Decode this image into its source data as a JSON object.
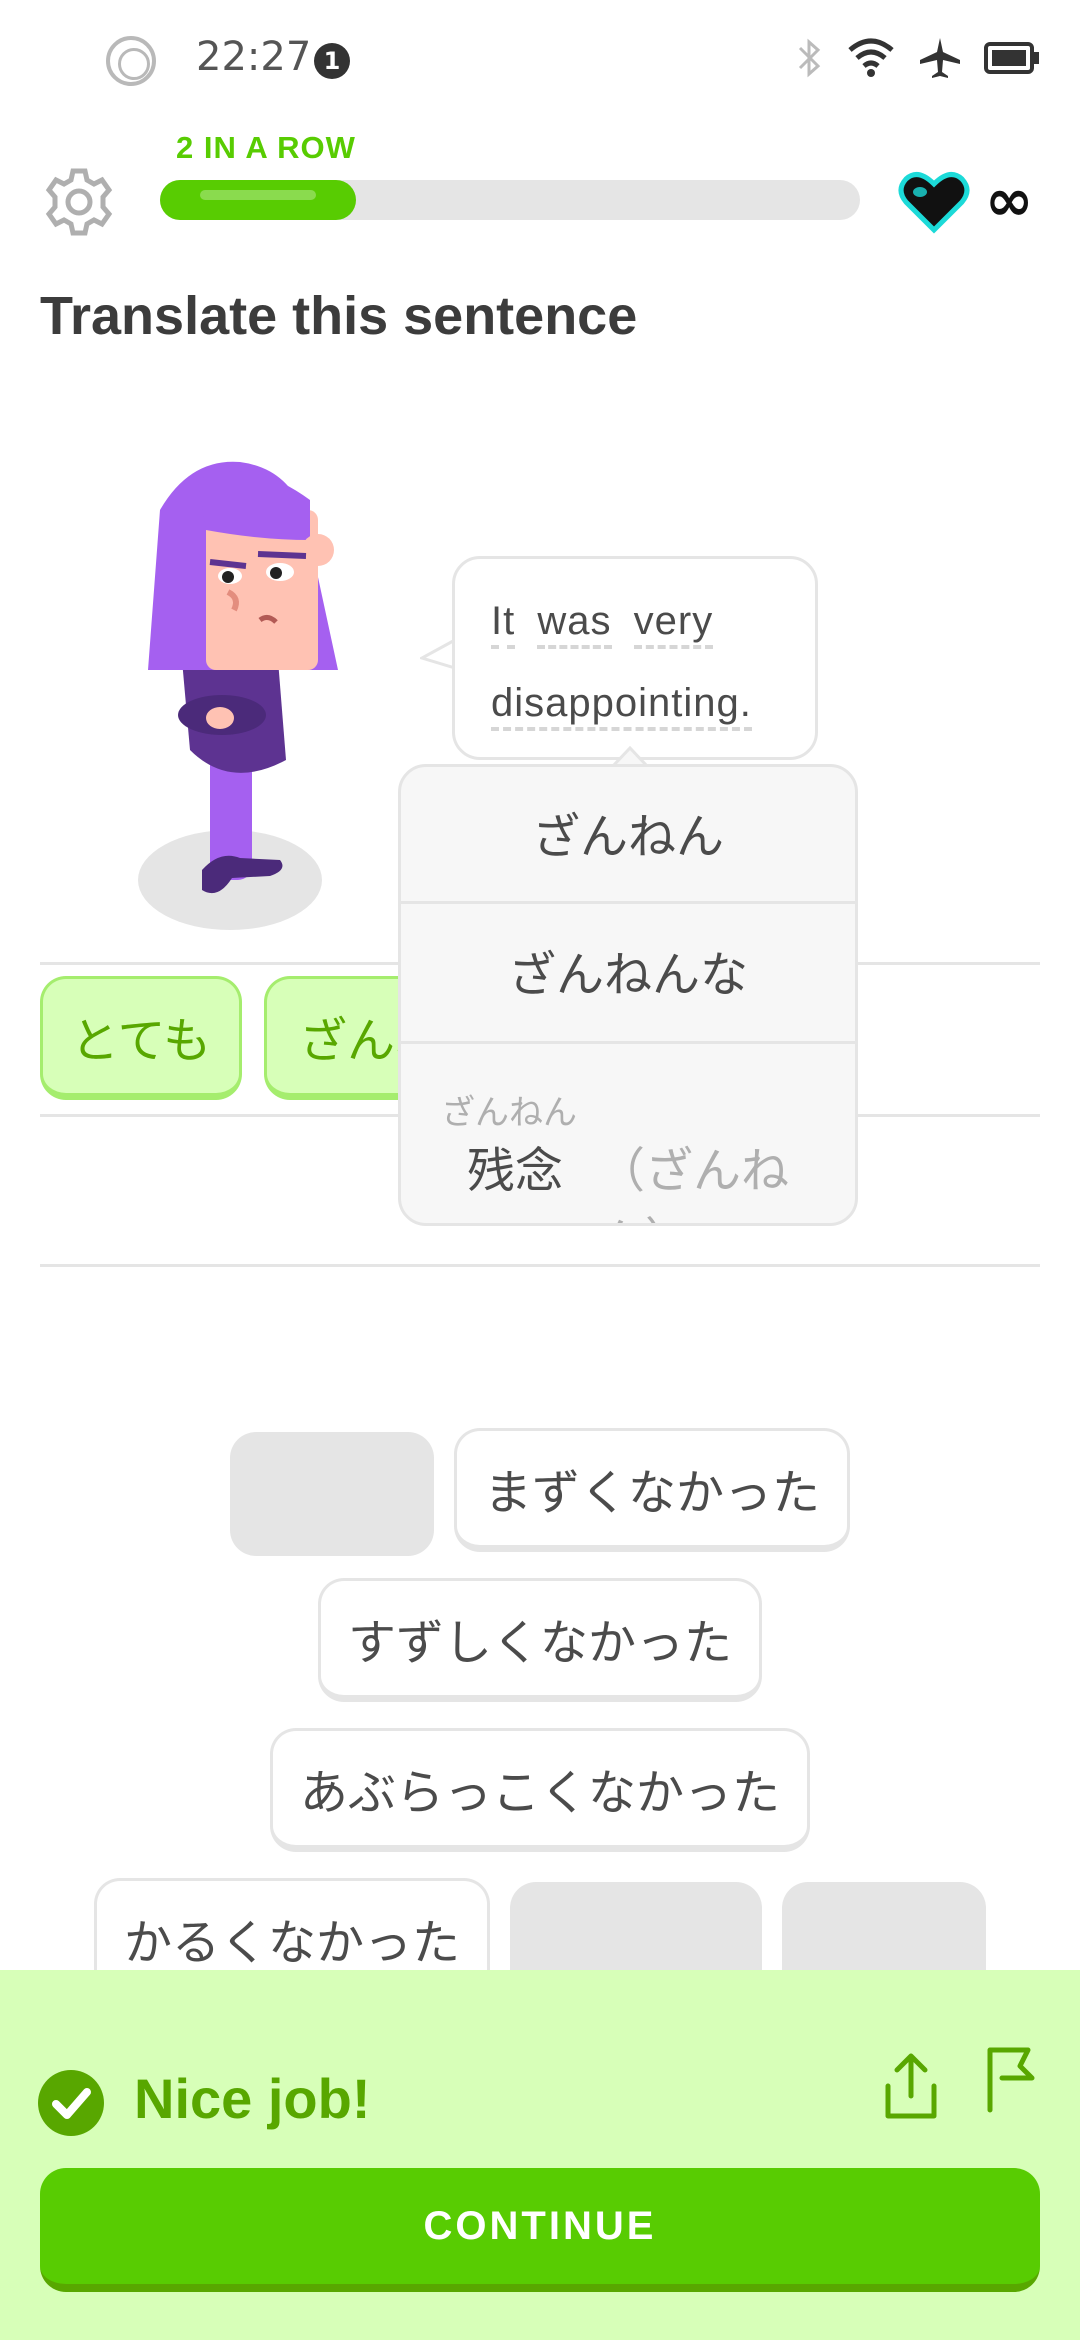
{
  "status_bar": {
    "time": "22:27",
    "notification_count": "1",
    "icons": [
      "bluetooth-icon",
      "wifi-icon",
      "airplane-mode-icon",
      "battery-icon"
    ]
  },
  "header": {
    "streak_label": "2 IN A ROW",
    "progress_fraction": 0.28,
    "hearts": "∞"
  },
  "instruction": "Translate this sentence",
  "prompt": {
    "line1_words": [
      "It",
      "was",
      "very"
    ],
    "line2_words": [
      "disappointing."
    ]
  },
  "hint_popup": {
    "option1": "ざんねん",
    "option2": "ざんねんな",
    "option3_ruby": "ざんねん",
    "option3_kanji": "残念",
    "option3_reading": "（ざんねん）"
  },
  "answer": {
    "chip1": "とても",
    "chip2": "ざんね"
  },
  "word_bank": {
    "chip_mazuku": "まずくなかった",
    "chip_suzushiku": "すずしくなかった",
    "chip_aburakkoku": "あぶらっこくなかった",
    "chip_karuku": "かるくなかった"
  },
  "feedback": {
    "message": "Nice job!",
    "continue_label": "CONTINUE"
  },
  "colors": {
    "green": "#58cc02",
    "dark_green": "#58a700",
    "feedback_bg": "#d7ffb8",
    "purple": "#a560f0"
  }
}
